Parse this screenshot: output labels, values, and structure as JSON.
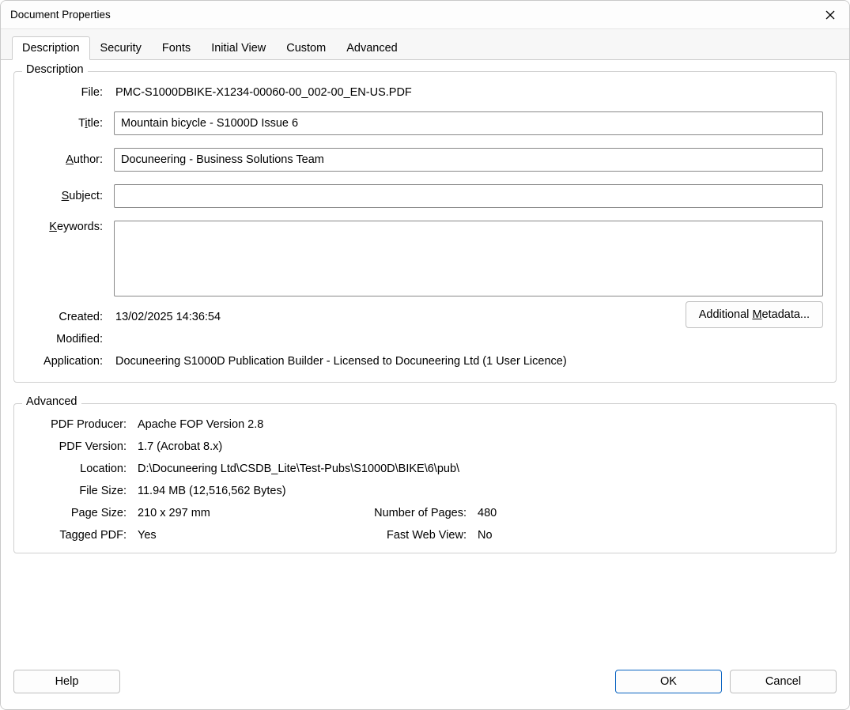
{
  "window": {
    "title": "Document Properties"
  },
  "tabs": {
    "description": "Description",
    "security": "Security",
    "fonts": "Fonts",
    "initialView": "Initial View",
    "custom": "Custom",
    "advanced": "Advanced"
  },
  "descriptionGroup": {
    "legend": "Description",
    "labels": {
      "file": "File:",
      "title_pre": "T",
      "title_u": "i",
      "title_post": "tle:",
      "author_u": "A",
      "author_post": "uthor:",
      "subject_u": "S",
      "subject_post": "ubject:",
      "keywords_u": "K",
      "keywords_post": "eywords:",
      "created": "Created:",
      "modified": "Modified:",
      "application": "Application:"
    },
    "values": {
      "file": "PMC-S1000DBIKE-X1234-00060-00_002-00_EN-US.PDF",
      "title": "Mountain bicycle - S1000D Issue 6",
      "author": "Docuneering - Business Solutions Team",
      "subject": "",
      "keywords": "",
      "created": "13/02/2025 14:36:54",
      "modified": "",
      "application": "Docuneering S1000D Publication Builder - Licensed to Docuneering Ltd (1 User Licence)"
    },
    "additionalMetadata_pre": "Additional ",
    "additionalMetadata_u": "M",
    "additionalMetadata_post": "etadata..."
  },
  "advancedGroup": {
    "legend": "Advanced",
    "labels": {
      "producer": "PDF Producer:",
      "version": "PDF Version:",
      "location": "Location:",
      "fileSize": "File Size:",
      "pageSize": "Page Size:",
      "numPages": "Number of Pages:",
      "tagged": "Tagged PDF:",
      "fastWeb": "Fast Web View:"
    },
    "values": {
      "producer": "Apache FOP Version 2.8",
      "version": "1.7 (Acrobat 8.x)",
      "location": "D:\\Docuneering Ltd\\CSDB_Lite\\Test-Pubs\\S1000D\\BIKE\\6\\pub\\",
      "fileSize": "11.94 MB (12,516,562 Bytes)",
      "pageSize": "210 x 297 mm",
      "numPages": "480",
      "tagged": "Yes",
      "fastWeb": "No"
    }
  },
  "footer": {
    "help": "Help",
    "ok": "OK",
    "cancel": "Cancel"
  }
}
